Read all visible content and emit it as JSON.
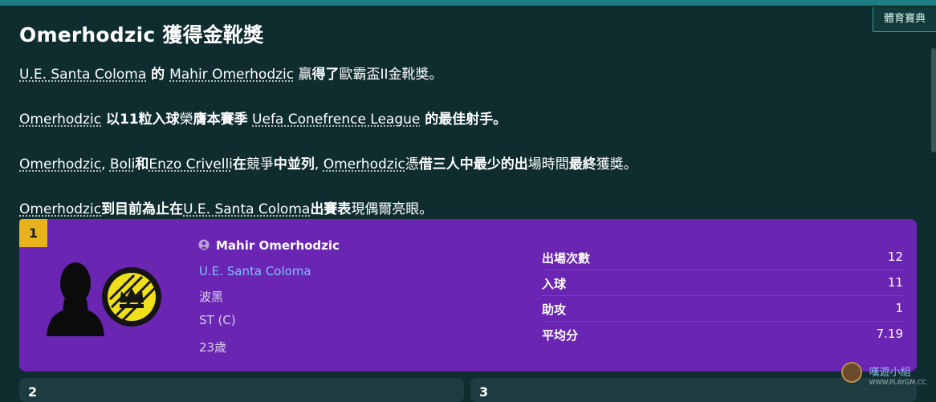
{
  "tag_label": "體育寶典",
  "title": "Omerhodzic 獲得金靴獎",
  "paragraphs": {
    "p1": {
      "club": "U.E. Santa Coloma",
      "t1": " 的 ",
      "player": "Mahir Omerhodzic",
      "t2": " 贏",
      "t3": "得了",
      "t4": "歐霸盃II金靴獎。"
    },
    "p2": {
      "player": "Omerhodzic",
      "t1": " 以11粒入球",
      "t2": "榮",
      "t3": "膺本賽季",
      "t4": " ",
      "comp": "Uefa Conefrence League",
      "t5": " 的最佳射手。"
    },
    "p3": {
      "p1": "Omerhodzic",
      "sep1": ", ",
      "p2": "Boli",
      "t1": "和",
      "p3": "Enzo Crivelli",
      "t2": "在",
      "t3": "競爭",
      "t4": "中並列",
      "sep2": ", ",
      "p4": "Omerhodzic",
      "t5": "憑",
      "t6": "借三人中最少的出",
      "t7": "場時間",
      "t8": "最終",
      "t9": "獲獎。"
    },
    "p4": {
      "player": "Omerhodzic",
      "t1": "到目前為止在",
      "club": "U.E. Santa Coloma",
      "t2": "出賽表",
      "t3": "現偶爾亮眼。"
    }
  },
  "card": {
    "rank": "1",
    "player_name": "Mahir Omerhodzic",
    "club": "U.E. Santa Coloma",
    "nationality": "波黑",
    "position": "ST (C)",
    "age": "23歲",
    "stats": [
      {
        "label": "出場次數",
        "value": "12"
      },
      {
        "label": "入球",
        "value": "11"
      },
      {
        "label": "助攻",
        "value": "1"
      },
      {
        "label": "平均分",
        "value": "7.19"
      }
    ]
  },
  "bottom_cards": [
    {
      "rank": "2"
    },
    {
      "rank": "3"
    }
  ],
  "watermark": {
    "text": "嘆遊小組",
    "url": "WWW.PLAYGM.CC"
  },
  "colors": {
    "background": "#0f2d2f",
    "card": "#6a25b3",
    "rank_badge": "#e7b21c",
    "club_link": "#7fc1ff",
    "topbar": "#1f7e83"
  },
  "icons": {
    "person": "person-icon",
    "silhouette": "player-silhouette-icon",
    "club_badge": "crown-badge-icon"
  }
}
